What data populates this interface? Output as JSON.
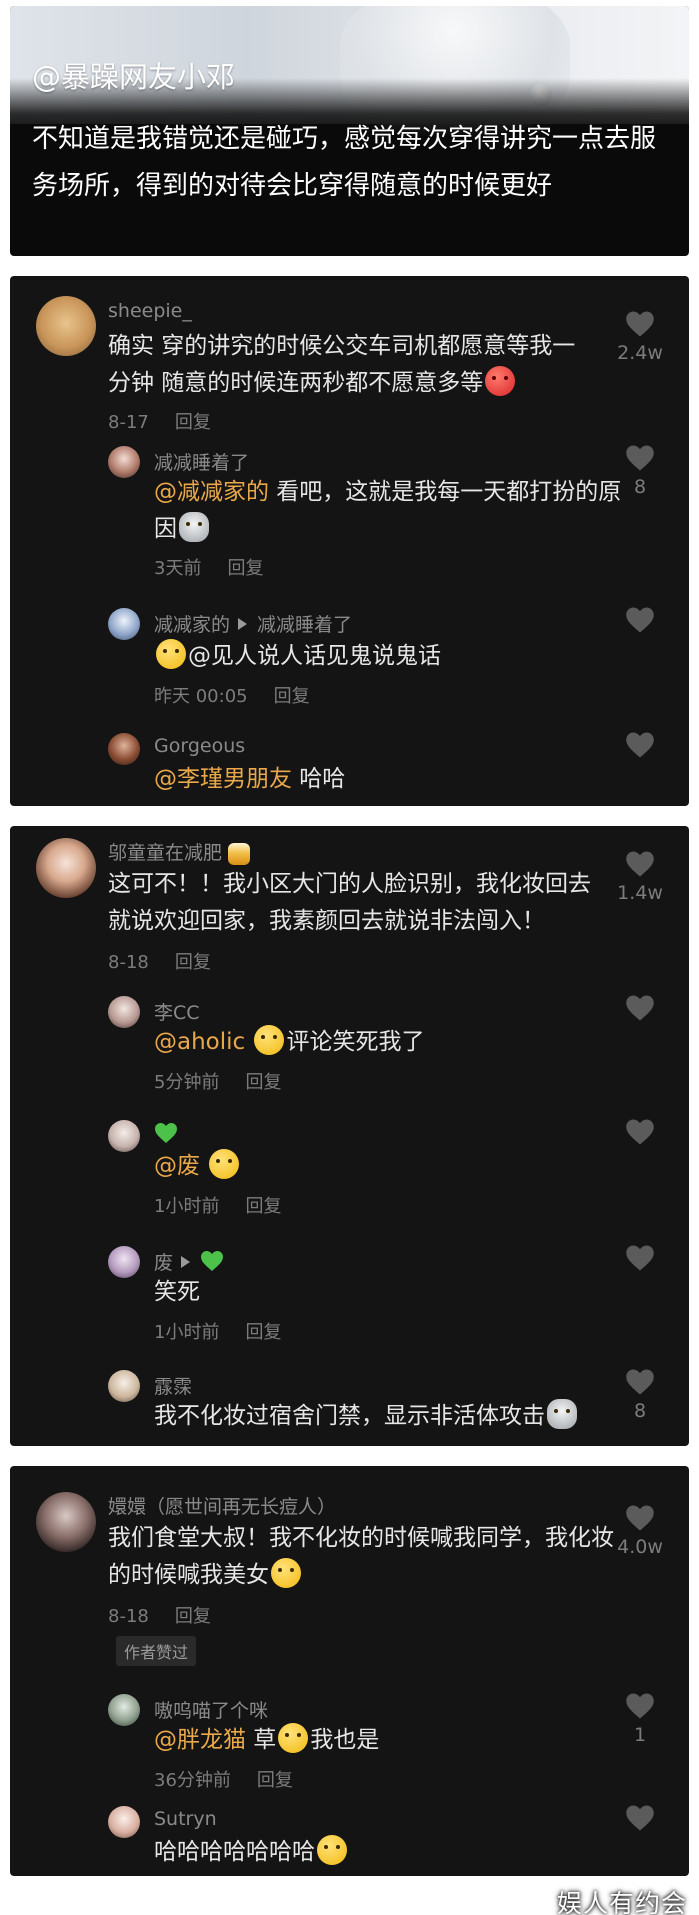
{
  "header": {
    "author": "@暴躁网友小邓",
    "text": "不知道是我错觉还是碰巧，感觉每次穿得讲究一点去服务场所，得到的对待会比穿得随意的时候更好"
  },
  "labels": {
    "reply": "回复",
    "author_liked": "作者赞过"
  },
  "colors": {
    "panel": "#141414",
    "mention": "#e9a84a",
    "muted": "#7c7c7c",
    "text": "#e6e6e6"
  },
  "panels": [
    {
      "comments": [
        {
          "user": "sheepie_",
          "text": "确实 穿的讲究的时候公交车司机都愿意等我一分钟 随意的时候连两秒都不愿意多等",
          "emoji": "angry-face",
          "date": "8-17",
          "likes": "2.4w"
        },
        {
          "user": "减减睡着了",
          "mention": "@减减家的",
          "text": " 看吧，这就是我每一天都打扮的原因",
          "emoji": "cat-face",
          "date": "3天前",
          "likes": "8"
        },
        {
          "user": "减减家的",
          "reply_to": "减减睡着了",
          "lead_emoji": "smirk-face",
          "text": "@见人说人话见鬼说鬼话",
          "date": "昨天 00:05",
          "likes": ""
        },
        {
          "user": "Gorgeous",
          "mention": "@李瑾男朋友",
          "text": " 哈哈",
          "likes": ""
        }
      ]
    },
    {
      "comments": [
        {
          "user": "邬童童在减肥",
          "user_emoji": "beer-icon",
          "text": "这可不！！我小区大门的人脸识别，我化妆回去就说欢迎回家，我素颜回去就说非法闯入！",
          "date": "8-18",
          "likes": "1.4w"
        },
        {
          "user": "李CC",
          "mention": "@aholic",
          "emoji": "laugh-cry-face",
          "text": "评论笑死我了",
          "date": "5分钟前",
          "likes": ""
        },
        {
          "user": "💚",
          "mention": "@废",
          "emoji": "rofl-face",
          "text": "",
          "date": "1小时前",
          "likes": ""
        },
        {
          "user": "废",
          "reply_to": "💚",
          "text": "笑死",
          "date": "1小时前",
          "likes": ""
        },
        {
          "user": "霡霂",
          "text": "我不化妆过宿舍门禁，显示非活体攻击",
          "emoji": "cat-face",
          "likes": "8"
        }
      ]
    },
    {
      "comments": [
        {
          "user": "嬛嬛（愿世间再无长痘人）",
          "text": "我们食堂大叔！我不化妆的时候喊我同学，我化妆的时候喊我美女",
          "emoji": "flushed-face",
          "date": "8-18",
          "likes": "4.0w"
        },
        {
          "user": "嗷呜喵了个咪",
          "mention": "@胖龙猫",
          "text": " 草",
          "emoji": "laugh-cry-face",
          "text2": "我也是",
          "date": "36分钟前",
          "likes": "1"
        },
        {
          "user": "Sutryn",
          "text": "哈哈哈哈哈哈哈",
          "emoji": "laugh-cry-face",
          "likes": ""
        }
      ]
    }
  ],
  "watermark": "娱人有约会"
}
